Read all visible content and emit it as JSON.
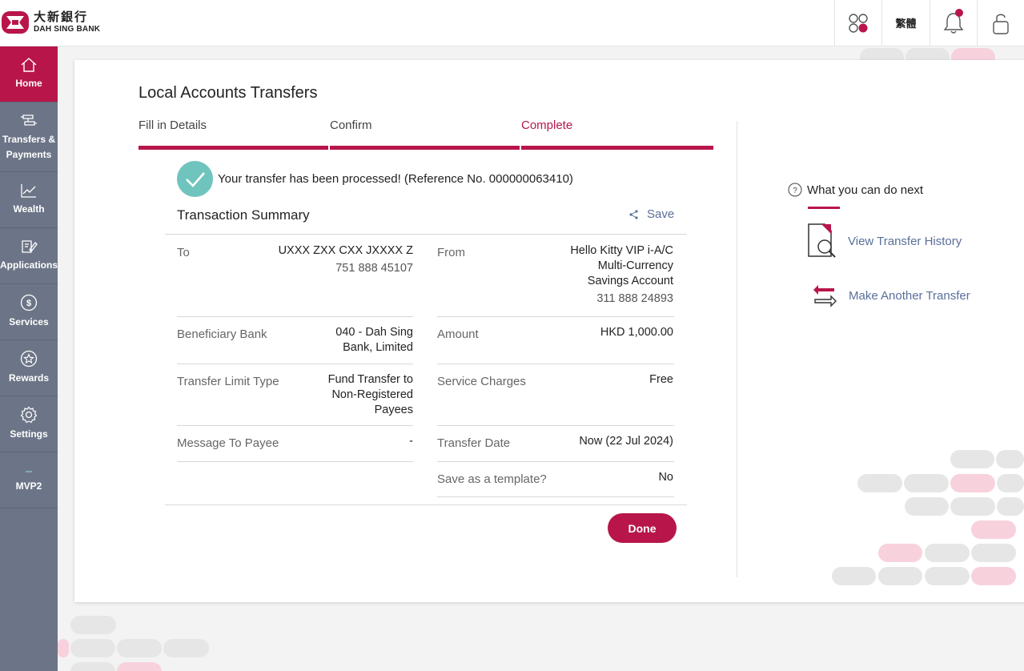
{
  "brand": {
    "name_cn": "大新銀行",
    "name_en": "DAH SING BANK"
  },
  "header": {
    "language_label": "繁體"
  },
  "sidebar": {
    "items": [
      {
        "label": "Home",
        "icon": "home-icon",
        "active": true
      },
      {
        "label": "Transfers & Payments",
        "icon": "transfer-icon",
        "active": false
      },
      {
        "label": "Wealth",
        "icon": "chart-icon",
        "active": false
      },
      {
        "label": "Applications",
        "icon": "edit-icon",
        "active": false
      },
      {
        "label": "Services",
        "icon": "dollar-icon",
        "active": false
      },
      {
        "label": "Rewards",
        "icon": "star-icon",
        "active": false
      },
      {
        "label": "Settings",
        "icon": "gear-icon",
        "active": false
      },
      {
        "label": "MVP2",
        "icon": "dash-icon",
        "active": false
      }
    ]
  },
  "main": {
    "title": "Local Accounts Transfers",
    "steps": [
      "Fill in Details",
      "Confirm",
      "Complete"
    ],
    "current_step": 2,
    "success_message": "Your transfer has been processed! (Reference No. 000000063410)",
    "summary_title": "Transaction Summary",
    "save_label": "Save",
    "fields": {
      "to_label": "To",
      "to_name": "UXXX ZXX CXX JXXXX Z",
      "to_account": "751 888 45107",
      "from_label": "From",
      "from_line1": "Hello Kitty VIP i-A/C",
      "from_line2": "Multi-Currency",
      "from_line3": "Savings Account",
      "from_account": "311 888 24893",
      "bank_label": "Beneficiary Bank",
      "bank_line1": "040 - Dah Sing",
      "bank_line2": "Bank, Limited",
      "amount_label": "Amount",
      "amount_value": "HKD 1,000.00",
      "limit_label": "Transfer Limit Type",
      "limit_line1": "Fund Transfer to",
      "limit_line2": "Non-Registered",
      "limit_line3": "Payees",
      "charges_label": "Service Charges",
      "charges_value": "Free",
      "message_label": "Message To Payee",
      "message_value": "-",
      "date_label": "Transfer Date",
      "date_value": "Now (22 Jul 2024)",
      "template_label": "Save as a template?",
      "template_value": "No"
    },
    "done_label": "Done"
  },
  "next": {
    "title": "What you can do next",
    "links": [
      "View Transfer History",
      "Make Another Transfer"
    ]
  },
  "colors": {
    "brand": "#b8164a",
    "sidebar": "#6c7587",
    "success": "#6fc5be",
    "link": "#5a6f9a"
  }
}
